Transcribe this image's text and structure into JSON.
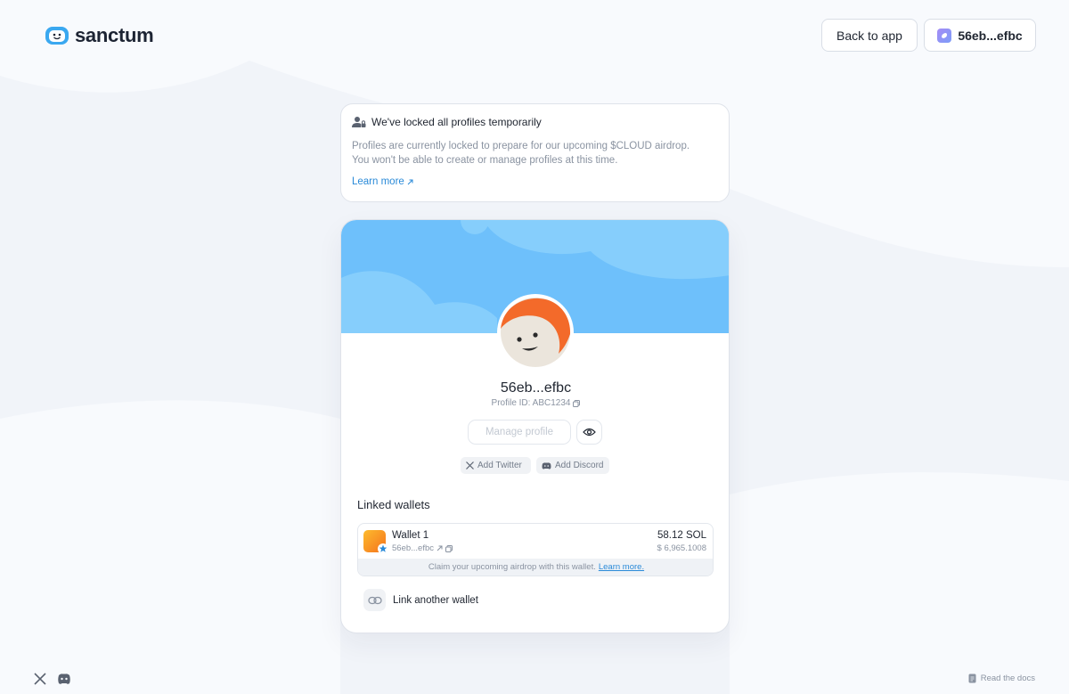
{
  "header": {
    "brand": "sanctum",
    "back_label": "Back to app",
    "wallet_label": "56eb...efbc"
  },
  "notice": {
    "title": "We've locked all profiles temporarily",
    "body_line1": "Profiles are currently locked to prepare for our upcoming $CLOUD airdrop.",
    "body_line2": "You won't be able to create or manage profiles at this time.",
    "link": "Learn more"
  },
  "profile": {
    "name": "56eb...efbc",
    "id_label": "Profile ID: ABC1234",
    "manage_label": "Manage profile",
    "twitter_label": "Add Twitter",
    "discord_label": "Add Discord"
  },
  "linked_wallets": {
    "title": "Linked wallets",
    "wallets": [
      {
        "name": "Wallet 1",
        "address": "56eb...efbc",
        "balance": "58.12 SOL",
        "usd": "$ 6,965.1008",
        "claim_text": "Claim your upcoming airdrop with this wallet.",
        "claim_link": "Learn more."
      }
    ],
    "link_another": "Link another wallet"
  },
  "footer": {
    "docs_label": "Read the docs"
  },
  "colors": {
    "accent": "#2a8ad8",
    "banner": "#6ec0fb",
    "avatar_hair": "#f36a2a"
  }
}
